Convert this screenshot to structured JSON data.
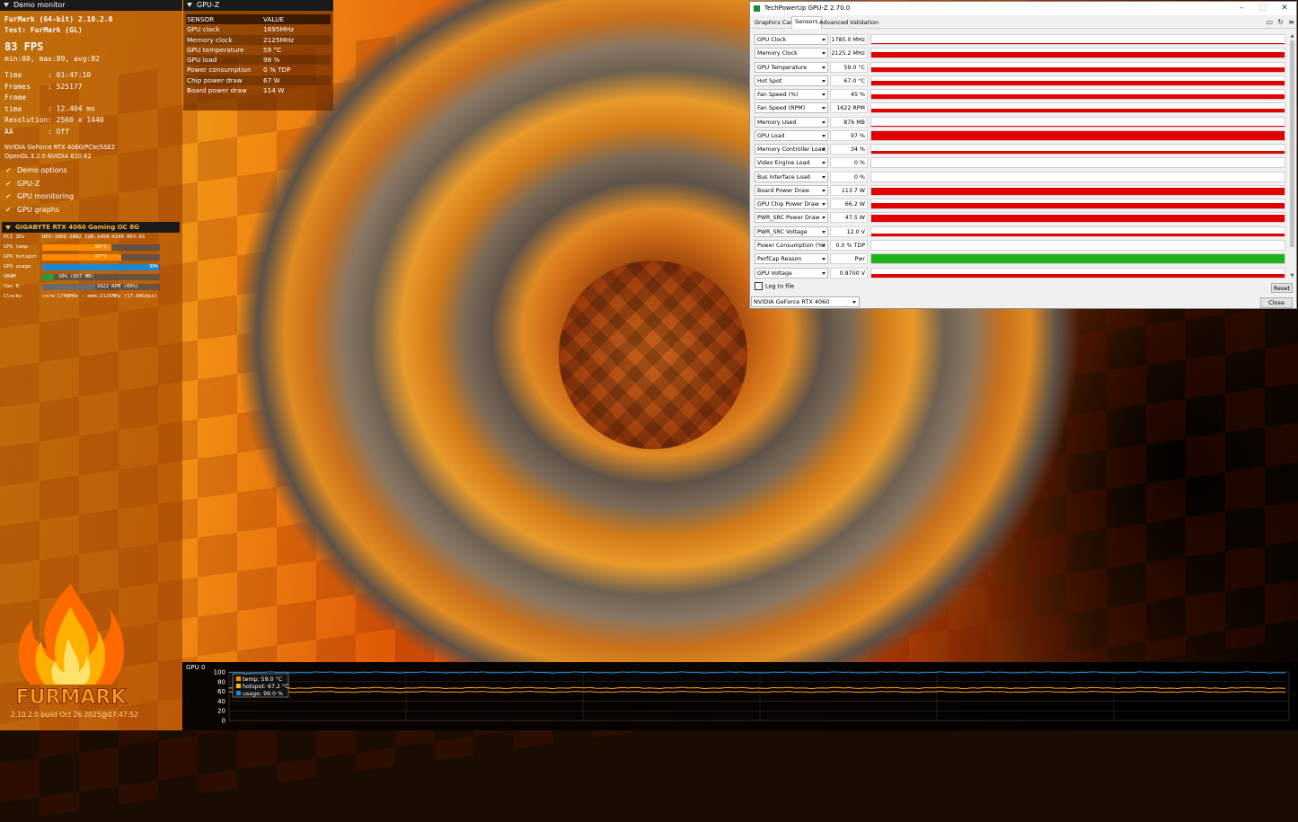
{
  "demo_monitor": {
    "title": "Demo monitor",
    "app_title": "FurMark (64-bit) 2.10.2.0",
    "test": "Test: FurMark (GL)",
    "fps": "83 FPS",
    "fps_stats": "min:80, max:89, avg:82",
    "stats": [
      {
        "key": "Time",
        "value": ": 01:47:10"
      },
      {
        "key": "Frames",
        "value": ": 525177"
      },
      {
        "key": "Frame time",
        "value": ": 12.404 ms"
      },
      {
        "key": "Resolution",
        "value": ": 2560 x 1440"
      },
      {
        "key": "AA",
        "value": ": Off"
      }
    ],
    "gpu_line": "NVIDIA GeForce RTX 4060/PCIe/SSE2",
    "gl_line": "OpenGL 3.2.0 NVIDIA 610.62",
    "options": [
      {
        "label": "Demo options",
        "checked": true
      },
      {
        "label": "GPU-Z",
        "checked": true
      },
      {
        "label": "GPU monitoring",
        "checked": true
      },
      {
        "label": "GPU graphs",
        "checked": true
      }
    ],
    "gpu_header": "GIGABYTE RTX 4060 Gaming OC 8G",
    "hw": {
      "pci_label": "PCI IDs",
      "pci_value": "DEV:10DE-2882 SUB:1458-4109 REV:A1",
      "temp_label": "GPU temp",
      "temp_value": "59°C",
      "temp_level": 0.59,
      "temp_color": "#ff8a00",
      "hotspot_label": "GPU hotspot",
      "hotspot_value": "67°C",
      "hotspot_level": 0.67,
      "hotspot_color": "#ff8a00",
      "usage_label": "GPU usage",
      "usage_value": "99%",
      "usage_level": 0.99,
      "usage_color": "#1a8ad4",
      "vram_label": "VRAM",
      "vram_value": "10% (857 MB)",
      "vram_level": 0.1,
      "vram_color": "#2a9a3a",
      "fan_label": "fan 0",
      "fan_value": "1622 RPM (45%)",
      "fan_level": 0.45,
      "fan_color": "#6a6a6a",
      "clocks_label": "Clocks",
      "clocks_value": "core:1740MHz - mem:2125MHz (17.00Gbps)"
    },
    "logo_text": "FURMARK",
    "build": "2.10.2.0 build Oct 26 2025@07:47:52"
  },
  "gpuz_overlay": {
    "title": "GPU-Z",
    "col_sensor": "SENSOR",
    "col_value": "VALUE",
    "rows": [
      {
        "k": "GPU clock",
        "v": "1695MHz"
      },
      {
        "k": "Memory clock",
        "v": "2125MHz"
      },
      {
        "k": "GPU temperature",
        "v": "59 °C"
      },
      {
        "k": "GPU load",
        "v": "98 %"
      },
      {
        "k": "Power consumption",
        "v": "0 % TDP"
      },
      {
        "k": "Chip power draw",
        "v": "67 W"
      },
      {
        "k": "Board power draw",
        "v": "114 W"
      }
    ]
  },
  "graph": {
    "title": "GPU 0",
    "y_ticks": [
      "100",
      "80",
      "60",
      "40",
      "20",
      "0"
    ],
    "legend": [
      {
        "label": "temp: 59.0 °C",
        "color": "#ff8a00"
      },
      {
        "label": "hotspot: 67.2 °C",
        "color": "#ffb020"
      },
      {
        "label": "usage: 99.0 %",
        "color": "#1a8ad4"
      }
    ],
    "series_levels": {
      "temp": 59,
      "hotspot": 67,
      "usage": 99
    }
  },
  "window": {
    "title": "TechPowerUp GPU-Z 2.70.0",
    "tabs": [
      "Graphics Card",
      "Sensors",
      "Advanced",
      "Validation"
    ],
    "active_tab": "Sensors",
    "sensors": [
      {
        "name": "GPU Clock",
        "value": "1785.0 MHz",
        "fill": 0.08,
        "color": "#e00000"
      },
      {
        "name": "Memory Clock",
        "value": "2125.2 MHz",
        "fill": 0.6,
        "color": "#e00000"
      },
      {
        "name": "GPU Temperature",
        "value": "59.0 °C",
        "fill": 0.45,
        "color": "#e00000"
      },
      {
        "name": "Hot Spot",
        "value": "67.0 °C",
        "fill": 0.5,
        "color": "#e00000"
      },
      {
        "name": "Fan Speed (%)",
        "value": "45 %",
        "fill": 0.45,
        "color": "#e00000"
      },
      {
        "name": "Fan Speed (RPM)",
        "value": "1622 RPM",
        "fill": 0.4,
        "color": "#e00000"
      },
      {
        "name": "Memory Used",
        "value": "876 MB",
        "fill": 0.1,
        "color": "#e00000"
      },
      {
        "name": "GPU Load",
        "value": "97 %",
        "fill": 0.97,
        "color": "#e00000"
      },
      {
        "name": "Memory Controller Load",
        "value": "34 %",
        "fill": 0.34,
        "color": "#e00000"
      },
      {
        "name": "Video Engine Load",
        "value": "0 %",
        "fill": 0,
        "color": "#e00000"
      },
      {
        "name": "Bus Interface Load",
        "value": "0 %",
        "fill": 0,
        "color": "#e00000"
      },
      {
        "name": "Board Power Draw",
        "value": "113.7 W",
        "fill": 0.75,
        "color": "#e00000"
      },
      {
        "name": "GPU Chip Power Draw",
        "value": "66.2 W",
        "fill": 0.6,
        "color": "#e00000"
      },
      {
        "name": "PWR_SRC Power Draw",
        "value": "47.5 W",
        "fill": 0.75,
        "color": "#e00000"
      },
      {
        "name": "PWR_SRC Voltage",
        "value": "12.0 V",
        "fill": 0.3,
        "color": "#e00000"
      },
      {
        "name": "Power Consumption (%)",
        "value": "0.0 % TDP",
        "fill": 0,
        "color": "#e00000"
      },
      {
        "name": "PerfCap Reason",
        "value": "Pwr",
        "fill": 1.0,
        "color": "#1db41d"
      },
      {
        "name": "GPU Voltage",
        "value": "0.8700 V",
        "fill": 0.35,
        "color": "#e00000"
      }
    ],
    "log_label": "Log to file",
    "reset_label": "Reset",
    "device": "NVIDIA GeForce RTX 4060",
    "close_label": "Close"
  }
}
